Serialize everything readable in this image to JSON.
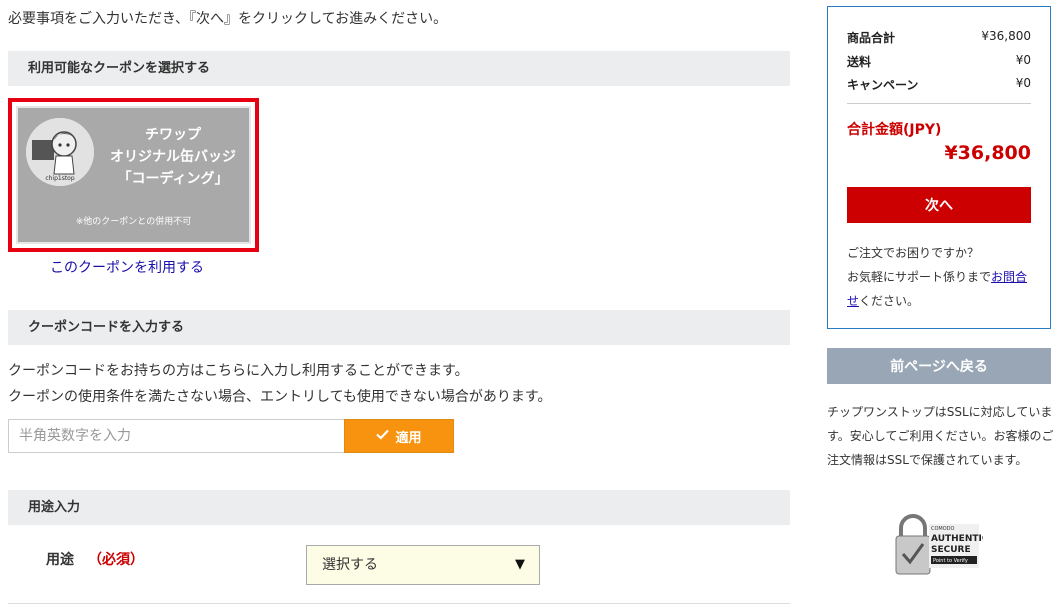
{
  "intro": "必要事項をご入力いただき、『次へ』をクリックしてお進みください。",
  "coupon_section": {
    "heading": "利用可能なクーポンを選択する",
    "coupon": {
      "title_lines": [
        "チワップ",
        "オリジナル缶バッジ",
        "「コーディング」"
      ],
      "note": "※他のクーポンとの併用不可"
    },
    "use_link": "このクーポンを利用する"
  },
  "code_section": {
    "heading": "クーポンコードを入力する",
    "desc1": "クーポンコードをお持ちの方はこちらに入力し利用することができます。",
    "desc2": "クーポンの使用条件を満たさない場合、エントリしても使用できない場合があります。",
    "input_placeholder": "半角英数字を入力",
    "input_value": "",
    "apply_label": "適用"
  },
  "usage_section": {
    "heading": "用途入力",
    "label": "用途",
    "required": "（必須）",
    "select_value": "選択する"
  },
  "summary": {
    "rows": [
      {
        "label": "商品合計",
        "value": "¥36,800"
      },
      {
        "label": "送料",
        "value": "¥0"
      },
      {
        "label": "キャンペーン",
        "value": "¥0"
      }
    ],
    "total_label": "合計金額(JPY)",
    "total_value": "¥36,800",
    "next_label": "次へ",
    "help_line1": "ご注文でお困りですか？",
    "help_line2_prefix": "お気軽にサポート係りまで",
    "help_link": "お問合せ",
    "help_suffix": "ください。"
  },
  "back_label": "前ページへ戻る",
  "ssl_text": "チップワンストップはSSLに対応しています。安心してご利用ください。お客様のご注文情報はSSLで保護されています。",
  "ssl_badge": {
    "brand": "COMODO",
    "line1": "AUTHENTIC",
    "line2": "SECURE",
    "line3": "Point to Verify"
  },
  "colors": {
    "accent_red": "#cc0000",
    "apply_orange": "#f7930f",
    "summary_border": "#2a7bc0",
    "back_button": "#99a6b6"
  }
}
